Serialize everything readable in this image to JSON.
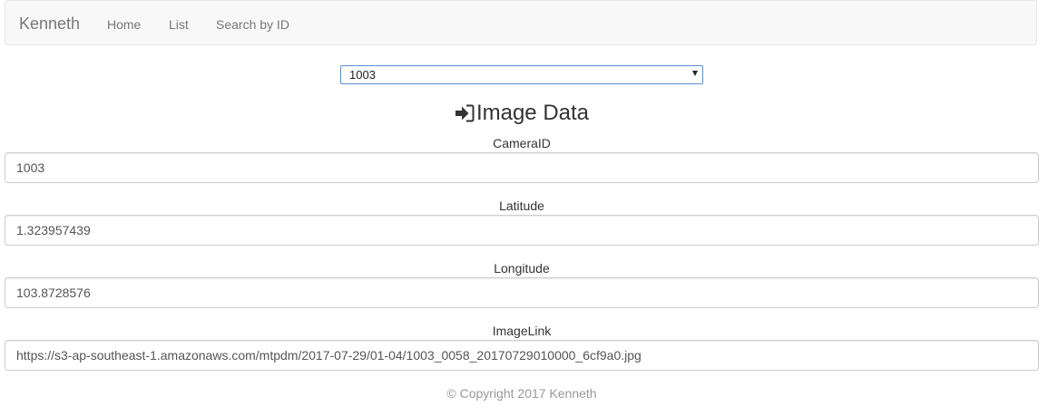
{
  "navbar": {
    "brand": "Kenneth",
    "items": [
      {
        "label": "Home"
      },
      {
        "label": "List"
      },
      {
        "label": "Search by ID"
      }
    ]
  },
  "camera_select": {
    "selected": "1003"
  },
  "heading": {
    "icon": "sign-in-icon",
    "text": "Image Data"
  },
  "fields": {
    "camera_id": {
      "label": "CameraID",
      "value": "1003"
    },
    "latitude": {
      "label": "Latitude",
      "value": "1.323957439"
    },
    "longitude": {
      "label": "Longitude",
      "value": "103.8728576"
    },
    "image_link": {
      "label": "ImageLink",
      "value": "https://s3-ap-southeast-1.amazonaws.com/mtpdm/2017-07-29/01-04/1003_0058_20170729010000_6cf9a0.jpg"
    }
  },
  "footer": {
    "text": "© Copyright 2017 Kenneth"
  },
  "colors": {
    "navbar_bg": "#f8f8f8",
    "select_border": "#5b8fd1",
    "input_border": "#cccccc",
    "footer_text": "#999999"
  }
}
